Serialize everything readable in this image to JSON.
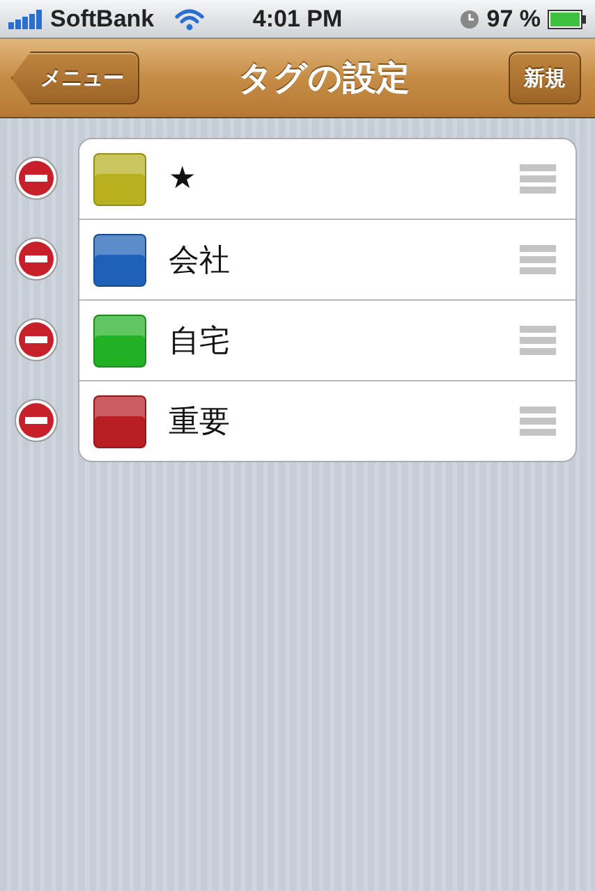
{
  "status_bar": {
    "carrier": "SoftBank",
    "time": "4:01 PM",
    "battery": "97 %"
  },
  "nav_bar": {
    "back_button": "メニュー",
    "title": "タグの設定",
    "action_button": "新規"
  },
  "tags": [
    {
      "name": "★",
      "color": "#b9b020"
    },
    {
      "name": "会社",
      "color": "#1f60b8"
    },
    {
      "name": "自宅",
      "color": "#22b024"
    },
    {
      "name": "重要",
      "color": "#b81e22"
    }
  ]
}
